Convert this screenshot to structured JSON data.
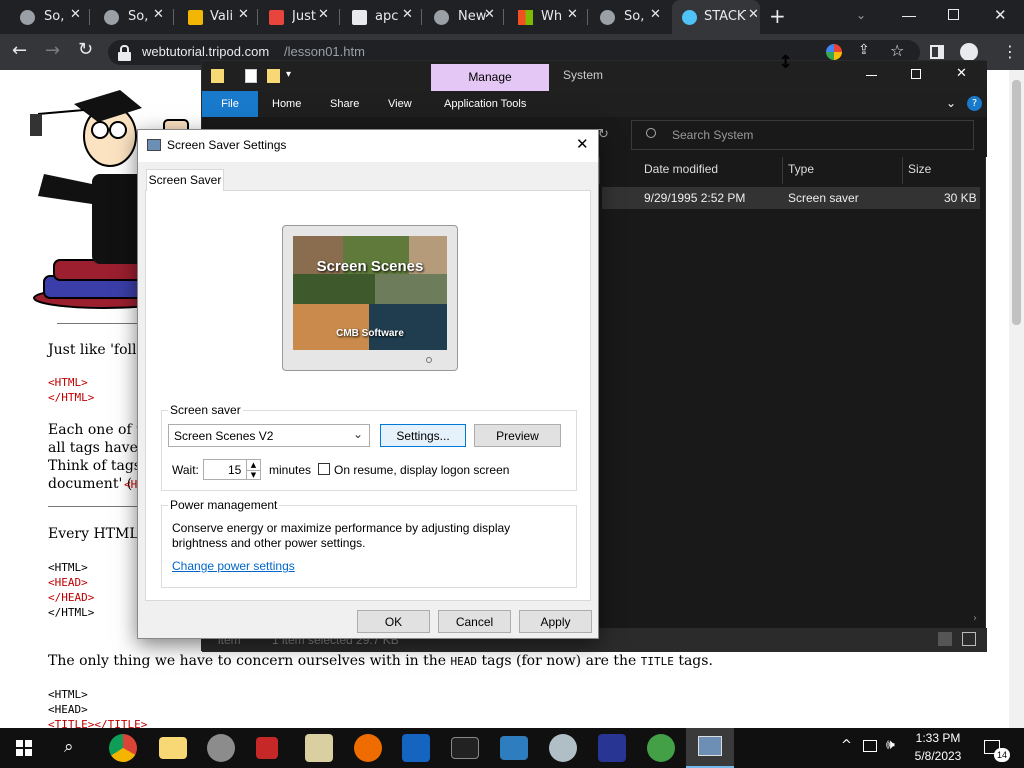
{
  "browser": {
    "tabs": [
      {
        "title": "So,",
        "favicon_color": "#9aa0a6"
      },
      {
        "title": "So,",
        "favicon_color": "#9aa0a6"
      },
      {
        "title": "Vali",
        "favicon_color": "#f2b705"
      },
      {
        "title": "Just",
        "favicon_color": "#e8453c"
      },
      {
        "title": "apc",
        "favicon_color": "#e8eaed"
      },
      {
        "title": "New",
        "favicon_color": "#9aa0a6"
      },
      {
        "title": "Wh",
        "favicon_color": "#f25022"
      },
      {
        "title": "So,",
        "favicon_color": "#9aa0a6"
      },
      {
        "title": "STACKT",
        "favicon_color": "#4fc3f7"
      }
    ],
    "close_glyph": "✕",
    "new_tab_glyph": "+",
    "url_host": "webtutorial.tripod.com",
    "url_path": "/lesson01.htm"
  },
  "webpage": {
    "line1": "Just like 'follo",
    "code1": [
      "<HTML>",
      "</HTML>"
    ],
    "para1": [
      "Each one of th",
      "all tags have a",
      "Think of tags",
      "document' ("
    ],
    "para1_code_tail": "<H",
    "line2": "Every HTML",
    "code2": [
      "<HTML>",
      "<HEAD>",
      "</HEAD>",
      "</HTML>"
    ],
    "line3_a": "The only thing we have to concern ourselves with in the ",
    "line3_code1": "HEAD",
    "line3_b": " tags (for now) are the ",
    "line3_code2": "TITLE",
    "line3_c": " tags.",
    "code3": [
      "<HTML>",
      "<HEAD>",
      "<TITLE></TITLE>"
    ]
  },
  "explorer": {
    "context_tab": "Manage",
    "context_group": "System",
    "ribbon_tabs": [
      "File",
      "Home",
      "Share",
      "View",
      "Application Tools"
    ],
    "search_placeholder": "Search System",
    "columns": [
      "Date modified",
      "Type",
      "Size"
    ],
    "row": {
      "date": "9/29/1995 2:52 PM",
      "type": "Screen saver",
      "size": "30 KB"
    },
    "status_items": "item",
    "status_selected": "1 item selected  29.7 KB"
  },
  "dialog": {
    "title": "Screen Saver Settings",
    "tab": "Screen Saver",
    "preview_title": "Screen Scenes",
    "preview_footer": "CMB Software",
    "screensaver_group": "Screen saver",
    "selected_saver": "Screen Scenes V2",
    "settings_button": "Settings...",
    "preview_button": "Preview",
    "wait_label": "Wait:",
    "wait_value": "15",
    "minutes_label": "minutes",
    "resume_label": "On resume, display logon screen",
    "resume_checked": false,
    "power_group": "Power management",
    "power_text1": "Conserve energy or maximize performance by adjusting display",
    "power_text2": "brightness and other power settings.",
    "power_link": "Change power settings",
    "ok": "OK",
    "cancel": "Cancel",
    "apply": "Apply"
  },
  "taskbar": {
    "time": "1:33 PM",
    "date": "5/8/2023",
    "notification_count": "14"
  }
}
